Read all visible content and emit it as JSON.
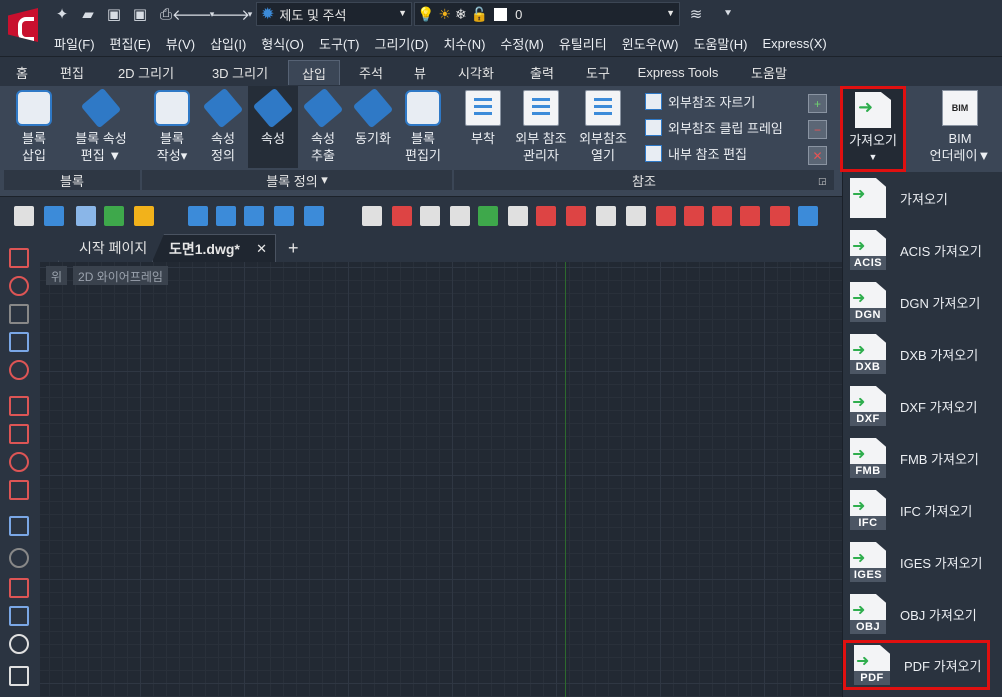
{
  "quick_access": {
    "workspace": "제도 및 주석",
    "layer_value": "0"
  },
  "menubar": [
    "파일(F)",
    "편집(E)",
    "뷰(V)",
    "삽입(I)",
    "형식(O)",
    "도구(T)",
    "그리기(D)",
    "치수(N)",
    "수정(M)",
    "유틸리티",
    "윈도우(W)",
    "도움말(H)",
    "Express(X)"
  ],
  "ribbon_tabs": [
    "홈",
    "편집",
    "2D 그리기",
    "3D 그리기",
    "삽입",
    "주석",
    "뷰",
    "시각화",
    "출력",
    "도구",
    "Express Tools",
    "도움말"
  ],
  "active_tab": "삽입",
  "panels": {
    "block": {
      "title": "블록",
      "btn_insert": [
        "블록",
        "삽입"
      ],
      "btn_attr_edit": [
        "블록 속성",
        "편집"
      ]
    },
    "block_def": {
      "title": "블록 정의",
      "btn_create": [
        "블록",
        "작성"
      ],
      "btn_attr_def": [
        "속성",
        "정의"
      ],
      "btn_attr": [
        "속성"
      ],
      "btn_attr_extract": [
        "속성",
        "추출"
      ],
      "btn_sync": [
        "동기화"
      ],
      "btn_block_editor": [
        "블록",
        "편집기"
      ]
    },
    "reference": {
      "title": "참조",
      "btn_attach": [
        "부착"
      ],
      "btn_xref_mgr": [
        "외부 참조",
        "관리자"
      ],
      "btn_xref_open": [
        "외부참조",
        "열기"
      ],
      "small_clip": "외부참조 자르기",
      "small_clip_frame": "외부참조 클립 프레임",
      "small_edit": "내부 참조 편집"
    },
    "import": {
      "btn_import": "가져오기"
    },
    "bim": {
      "btn_bim": [
        "BIM",
        "언더레이"
      ]
    }
  },
  "doc_tabs": {
    "start": "시작 페이지",
    "drawing": "도면1.dwg*",
    "close": "✕",
    "add": "+"
  },
  "viewport": {
    "view": "위",
    "style": "2D 와이어프레임"
  },
  "import_menu": [
    {
      "label": "가져오기",
      "tag": ""
    },
    {
      "label": "ACIS 가져오기",
      "tag": "ACIS"
    },
    {
      "label": "DGN 가져오기",
      "tag": "DGN"
    },
    {
      "label": "DXB 가져오기",
      "tag": "DXB"
    },
    {
      "label": "DXF 가져오기",
      "tag": "DXF"
    },
    {
      "label": "FMB 가져오기",
      "tag": "FMB"
    },
    {
      "label": "IFC 가져오기",
      "tag": "IFC"
    },
    {
      "label": "IGES 가져오기",
      "tag": "IGES"
    },
    {
      "label": "OBJ 가져오기",
      "tag": "OBJ"
    },
    {
      "label": "PDF 가져오기",
      "tag": "PDF"
    }
  ],
  "highlight_color": "#e01010"
}
